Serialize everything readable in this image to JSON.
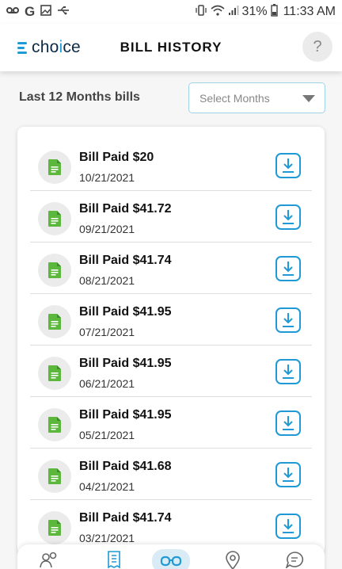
{
  "status_bar": {
    "battery_percent": "31%",
    "time": "11:33 AM",
    "left_icons": [
      "voicemail-icon",
      "google-icon",
      "image-icon",
      "usb-icon"
    ],
    "right_icons": [
      "vibrate-icon",
      "wifi-icon",
      "signal-icon",
      "battery-icon"
    ]
  },
  "header": {
    "logo_prefix": "cho",
    "logo_accent": "i",
    "logo_suffix": "ce",
    "title": "BILL HISTORY",
    "help_label": "?"
  },
  "filter": {
    "label": "Last 12 Months bills",
    "select_placeholder": "Select Months"
  },
  "bills": [
    {
      "title": "Bill Paid $20",
      "date": "10/21/2021"
    },
    {
      "title": "Bill Paid $41.72",
      "date": "09/21/2021"
    },
    {
      "title": "Bill Paid $41.74",
      "date": "08/21/2021"
    },
    {
      "title": "Bill Paid $41.95",
      "date": "07/21/2021"
    },
    {
      "title": "Bill Paid $41.95",
      "date": "06/21/2021"
    },
    {
      "title": "Bill Paid $41.95",
      "date": "05/21/2021"
    },
    {
      "title": "Bill Paid $41.68",
      "date": "04/21/2021"
    },
    {
      "title": "Bill Paid $41.74",
      "date": "03/21/2021"
    }
  ],
  "bottom_nav": {
    "items": [
      "users-icon",
      "receipt-icon",
      "glasses-icon",
      "location-pin-icon",
      "chat-icon"
    ],
    "active_index": 2
  },
  "colors": {
    "accent": "#1f9ad6",
    "doc_icon": "#5cb83c",
    "brand_dark": "#0d2a45"
  }
}
